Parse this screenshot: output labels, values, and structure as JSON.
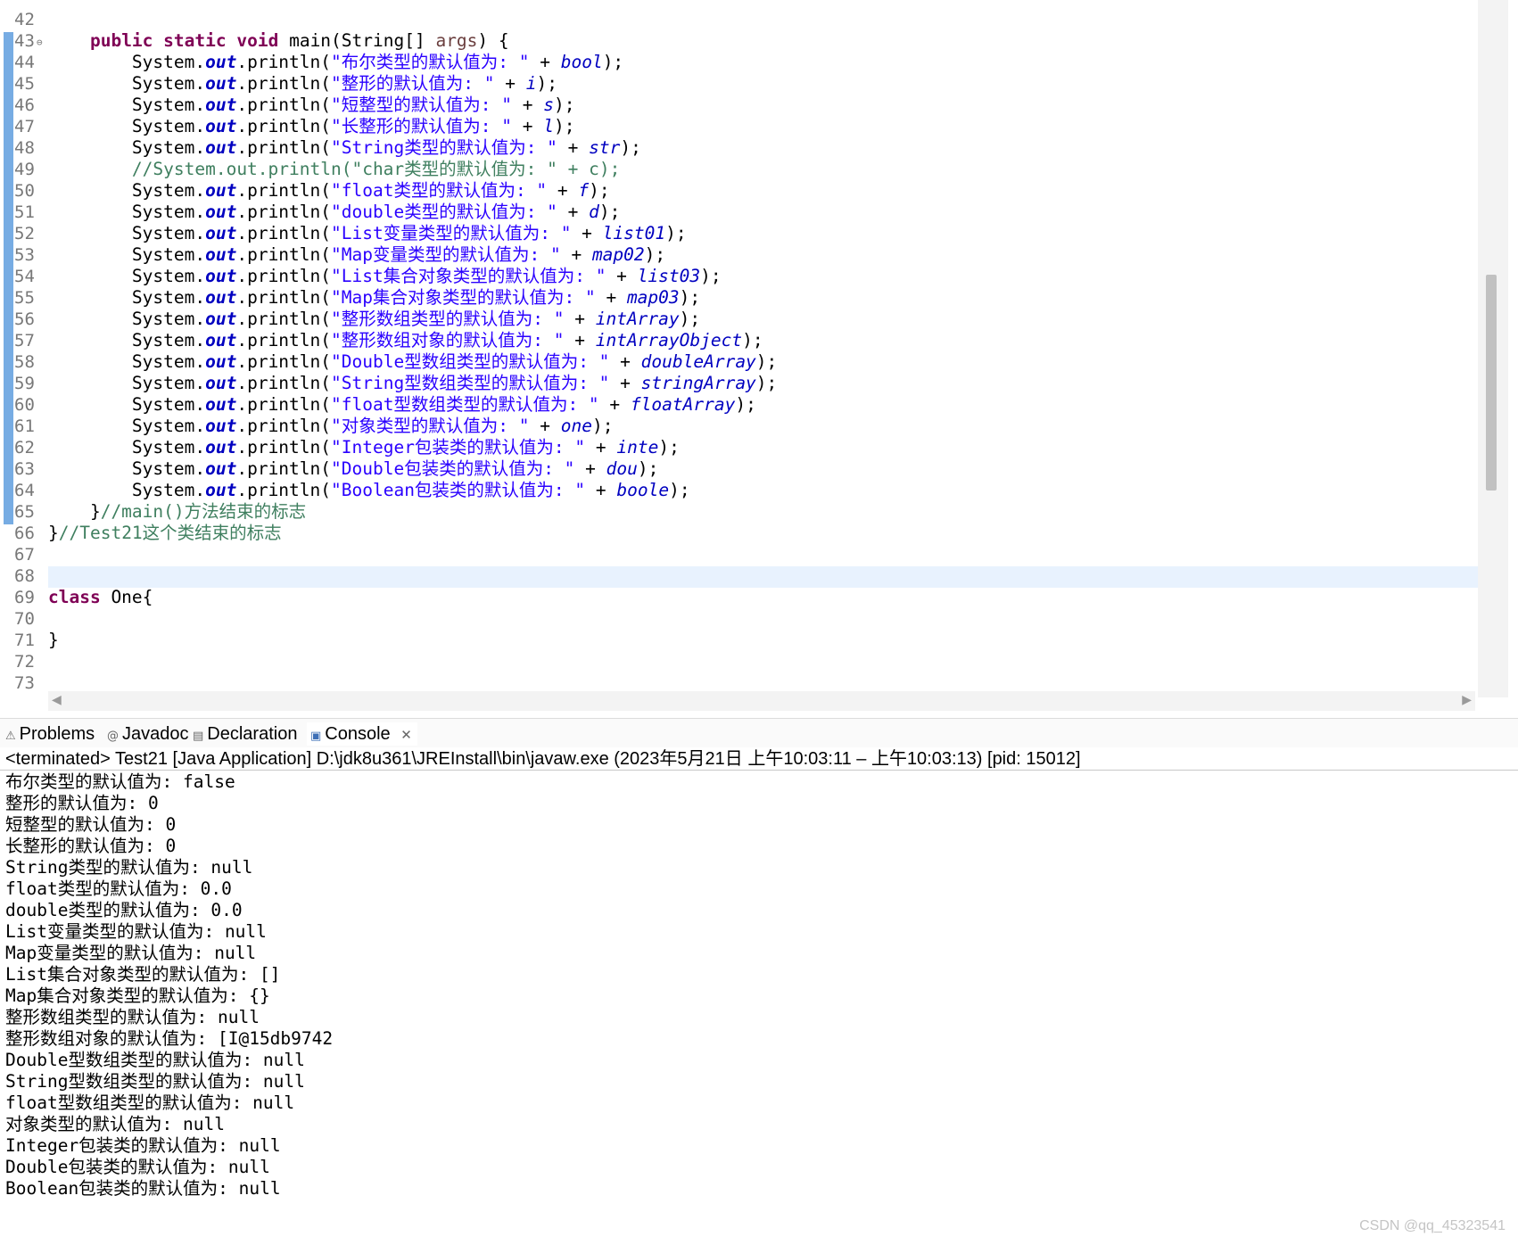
{
  "editor": {
    "lines": [
      {
        "n": "42",
        "fold": "",
        "segs": []
      },
      {
        "n": "43",
        "fold": "⊖",
        "segs": [
          [
            "plain",
            "    "
          ],
          [
            "kw",
            "public"
          ],
          [
            "plain",
            " "
          ],
          [
            "kw",
            "static"
          ],
          [
            "plain",
            " "
          ],
          [
            "kw",
            "void"
          ],
          [
            "plain",
            " main(String[] "
          ],
          [
            "prm",
            "args"
          ],
          [
            "plain",
            ") {"
          ]
        ]
      },
      {
        "n": "44",
        "fold": "",
        "segs": [
          [
            "plain",
            "        System."
          ],
          [
            "fld",
            "out"
          ],
          [
            "plain",
            ".println("
          ],
          [
            "str",
            "\"布尔类型的默认值为: \""
          ],
          [
            "plain",
            " + "
          ],
          [
            "var",
            "bool"
          ],
          [
            "plain",
            ");"
          ]
        ]
      },
      {
        "n": "45",
        "fold": "",
        "segs": [
          [
            "plain",
            "        System."
          ],
          [
            "fld",
            "out"
          ],
          [
            "plain",
            ".println("
          ],
          [
            "str",
            "\"整形的默认值为: \""
          ],
          [
            "plain",
            " + "
          ],
          [
            "var",
            "i"
          ],
          [
            "plain",
            ");"
          ]
        ]
      },
      {
        "n": "46",
        "fold": "",
        "segs": [
          [
            "plain",
            "        System."
          ],
          [
            "fld",
            "out"
          ],
          [
            "plain",
            ".println("
          ],
          [
            "str",
            "\"短整型的默认值为: \""
          ],
          [
            "plain",
            " + "
          ],
          [
            "var",
            "s"
          ],
          [
            "plain",
            ");"
          ]
        ]
      },
      {
        "n": "47",
        "fold": "",
        "segs": [
          [
            "plain",
            "        System."
          ],
          [
            "fld",
            "out"
          ],
          [
            "plain",
            ".println("
          ],
          [
            "str",
            "\"长整形的默认值为: \""
          ],
          [
            "plain",
            " + "
          ],
          [
            "var",
            "l"
          ],
          [
            "plain",
            ");"
          ]
        ]
      },
      {
        "n": "48",
        "fold": "",
        "segs": [
          [
            "plain",
            "        System."
          ],
          [
            "fld",
            "out"
          ],
          [
            "plain",
            ".println("
          ],
          [
            "str",
            "\"String类型的默认值为: \""
          ],
          [
            "plain",
            " + "
          ],
          [
            "var",
            "str"
          ],
          [
            "plain",
            ");"
          ]
        ]
      },
      {
        "n": "49",
        "fold": "",
        "segs": [
          [
            "plain",
            "        "
          ],
          [
            "cmt",
            "//System.out.println(\"char类型的默认值为: \" + c);"
          ]
        ]
      },
      {
        "n": "50",
        "fold": "",
        "segs": [
          [
            "plain",
            "        System."
          ],
          [
            "fld",
            "out"
          ],
          [
            "plain",
            ".println("
          ],
          [
            "str",
            "\"float类型的默认值为: \""
          ],
          [
            "plain",
            " + "
          ],
          [
            "var",
            "f"
          ],
          [
            "plain",
            ");"
          ]
        ]
      },
      {
        "n": "51",
        "fold": "",
        "segs": [
          [
            "plain",
            "        System."
          ],
          [
            "fld",
            "out"
          ],
          [
            "plain",
            ".println("
          ],
          [
            "str",
            "\"double类型的默认值为: \""
          ],
          [
            "plain",
            " + "
          ],
          [
            "var",
            "d"
          ],
          [
            "plain",
            ");"
          ]
        ]
      },
      {
        "n": "52",
        "fold": "",
        "segs": [
          [
            "plain",
            "        System."
          ],
          [
            "fld",
            "out"
          ],
          [
            "plain",
            ".println("
          ],
          [
            "str",
            "\"List变量类型的默认值为: \""
          ],
          [
            "plain",
            " + "
          ],
          [
            "var",
            "list01"
          ],
          [
            "plain",
            ");"
          ]
        ]
      },
      {
        "n": "53",
        "fold": "",
        "segs": [
          [
            "plain",
            "        System."
          ],
          [
            "fld",
            "out"
          ],
          [
            "plain",
            ".println("
          ],
          [
            "str",
            "\"Map变量类型的默认值为: \""
          ],
          [
            "plain",
            " + "
          ],
          [
            "var",
            "map02"
          ],
          [
            "plain",
            ");"
          ]
        ]
      },
      {
        "n": "54",
        "fold": "",
        "segs": [
          [
            "plain",
            "        System."
          ],
          [
            "fld",
            "out"
          ],
          [
            "plain",
            ".println("
          ],
          [
            "str",
            "\"List集合对象类型的默认值为: \""
          ],
          [
            "plain",
            " + "
          ],
          [
            "var",
            "list03"
          ],
          [
            "plain",
            ");"
          ]
        ]
      },
      {
        "n": "55",
        "fold": "",
        "segs": [
          [
            "plain",
            "        System."
          ],
          [
            "fld",
            "out"
          ],
          [
            "plain",
            ".println("
          ],
          [
            "str",
            "\"Map集合对象类型的默认值为: \""
          ],
          [
            "plain",
            " + "
          ],
          [
            "var",
            "map03"
          ],
          [
            "plain",
            ");"
          ]
        ]
      },
      {
        "n": "56",
        "fold": "",
        "segs": [
          [
            "plain",
            "        System."
          ],
          [
            "fld",
            "out"
          ],
          [
            "plain",
            ".println("
          ],
          [
            "str",
            "\"整形数组类型的默认值为: \""
          ],
          [
            "plain",
            " + "
          ],
          [
            "var",
            "intArray"
          ],
          [
            "plain",
            ");"
          ]
        ]
      },
      {
        "n": "57",
        "fold": "",
        "segs": [
          [
            "plain",
            "        System."
          ],
          [
            "fld",
            "out"
          ],
          [
            "plain",
            ".println("
          ],
          [
            "str",
            "\"整形数组对象的默认值为: \""
          ],
          [
            "plain",
            " + "
          ],
          [
            "var",
            "intArrayObject"
          ],
          [
            "plain",
            ");"
          ]
        ]
      },
      {
        "n": "58",
        "fold": "",
        "segs": [
          [
            "plain",
            "        System."
          ],
          [
            "fld",
            "out"
          ],
          [
            "plain",
            ".println("
          ],
          [
            "str",
            "\"Double型数组类型的默认值为: \""
          ],
          [
            "plain",
            " + "
          ],
          [
            "var",
            "doubleArray"
          ],
          [
            "plain",
            ");"
          ]
        ]
      },
      {
        "n": "59",
        "fold": "",
        "segs": [
          [
            "plain",
            "        System."
          ],
          [
            "fld",
            "out"
          ],
          [
            "plain",
            ".println("
          ],
          [
            "str",
            "\"String型数组类型的默认值为: \""
          ],
          [
            "plain",
            " + "
          ],
          [
            "var",
            "stringArray"
          ],
          [
            "plain",
            ");"
          ]
        ]
      },
      {
        "n": "60",
        "fold": "",
        "segs": [
          [
            "plain",
            "        System."
          ],
          [
            "fld",
            "out"
          ],
          [
            "plain",
            ".println("
          ],
          [
            "str",
            "\"float型数组类型的默认值为: \""
          ],
          [
            "plain",
            " + "
          ],
          [
            "var",
            "floatArray"
          ],
          [
            "plain",
            ");"
          ]
        ]
      },
      {
        "n": "61",
        "fold": "",
        "segs": [
          [
            "plain",
            "        System."
          ],
          [
            "fld",
            "out"
          ],
          [
            "plain",
            ".println("
          ],
          [
            "str",
            "\"对象类型的默认值为: \""
          ],
          [
            "plain",
            " + "
          ],
          [
            "var",
            "one"
          ],
          [
            "plain",
            ");"
          ]
        ]
      },
      {
        "n": "62",
        "fold": "",
        "segs": [
          [
            "plain",
            "        System."
          ],
          [
            "fld",
            "out"
          ],
          [
            "plain",
            ".println("
          ],
          [
            "str",
            "\"Integer包装类的默认值为: \""
          ],
          [
            "plain",
            " + "
          ],
          [
            "var",
            "inte"
          ],
          [
            "plain",
            ");"
          ]
        ]
      },
      {
        "n": "63",
        "fold": "",
        "segs": [
          [
            "plain",
            "        System."
          ],
          [
            "fld",
            "out"
          ],
          [
            "plain",
            ".println("
          ],
          [
            "str",
            "\"Double包装类的默认值为: \""
          ],
          [
            "plain",
            " + "
          ],
          [
            "var",
            "dou"
          ],
          [
            "plain",
            ");"
          ]
        ]
      },
      {
        "n": "64",
        "fold": "",
        "segs": [
          [
            "plain",
            "        System."
          ],
          [
            "fld",
            "out"
          ],
          [
            "plain",
            ".println("
          ],
          [
            "str",
            "\"Boolean包装类的默认值为: \""
          ],
          [
            "plain",
            " + "
          ],
          [
            "var",
            "boole"
          ],
          [
            "plain",
            ");"
          ]
        ]
      },
      {
        "n": "65",
        "fold": "",
        "segs": [
          [
            "plain",
            "    }"
          ],
          [
            "cmt",
            "//main()方法结束的标志"
          ]
        ]
      },
      {
        "n": "66",
        "fold": "",
        "segs": [
          [
            "plain",
            "}"
          ],
          [
            "cmt",
            "//Test21这个类结束的标志"
          ]
        ]
      },
      {
        "n": "67",
        "fold": "",
        "segs": []
      },
      {
        "n": "68",
        "fold": "",
        "segs": []
      },
      {
        "n": "69",
        "fold": "",
        "segs": [
          [
            "kw",
            "class"
          ],
          [
            "plain",
            " One{"
          ]
        ]
      },
      {
        "n": "70",
        "fold": "",
        "segs": []
      },
      {
        "n": "71",
        "fold": "",
        "segs": [
          [
            "plain",
            "}"
          ]
        ]
      },
      {
        "n": "72",
        "fold": "",
        "segs": []
      },
      {
        "n": "73",
        "fold": "",
        "segs": []
      }
    ]
  },
  "scroll": {
    "left_arrow": "◀",
    "right_arrow": "▶"
  },
  "tabs": [
    {
      "icon": "⚠",
      "icon_name": "problems-icon",
      "label": "Problems",
      "active": false
    },
    {
      "icon": "@",
      "icon_name": "javadoc-icon",
      "label": "Javadoc",
      "active": false
    },
    {
      "icon": "▤",
      "icon_name": "declaration-icon",
      "label": "Declaration",
      "active": false
    },
    {
      "icon": "▣",
      "icon_name": "console-icon",
      "label": "Console",
      "active": true,
      "close": "✕"
    }
  ],
  "console": {
    "header": "<terminated> Test21 [Java Application] D:\\jdk8u361\\JREInstall\\bin\\javaw.exe  (2023年5月21日 上午10:03:11 – 上午10:03:13) [pid: 15012]",
    "lines": [
      "布尔类型的默认值为: false",
      "整形的默认值为: 0",
      "短整型的默认值为: 0",
      "长整形的默认值为: 0",
      "String类型的默认值为: null",
      "float类型的默认值为: 0.0",
      "double类型的默认值为: 0.0",
      "List变量类型的默认值为: null",
      "Map变量类型的默认值为: null",
      "List集合对象类型的默认值为: []",
      "Map集合对象类型的默认值为: {}",
      "整形数组类型的默认值为: null",
      "整形数组对象的默认值为: [I@15db9742",
      "Double型数组类型的默认值为: null",
      "String型数组类型的默认值为: null",
      "float型数组类型的默认值为: null",
      "对象类型的默认值为: null",
      "Integer包装类的默认值为: null",
      "Double包装类的默认值为: null",
      "Boolean包装类的默认值为: null"
    ]
  },
  "watermark": "CSDN @qq_45323541"
}
